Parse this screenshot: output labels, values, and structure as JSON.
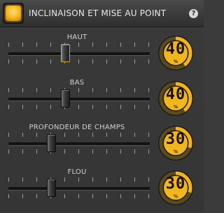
{
  "header": {
    "title": "INCLINAISON ET MISE AU POINT",
    "help_label": "?",
    "toggle_on": true
  },
  "accent_color": "#f5b31a",
  "sliders": [
    {
      "label": "HAUT",
      "value": 40,
      "unit": "%",
      "position_fraction": 0.4,
      "active": true
    },
    {
      "label": "BAS",
      "value": 40,
      "unit": "%",
      "position_fraction": 0.4,
      "active": false
    },
    {
      "label": "PROFONDEUR DE CHAMPS",
      "value": 30,
      "unit": "%",
      "position_fraction": 0.3,
      "active": false
    },
    {
      "label": "FLOU",
      "value": 30,
      "unit": "%",
      "position_fraction": 0.3,
      "active": false
    }
  ]
}
